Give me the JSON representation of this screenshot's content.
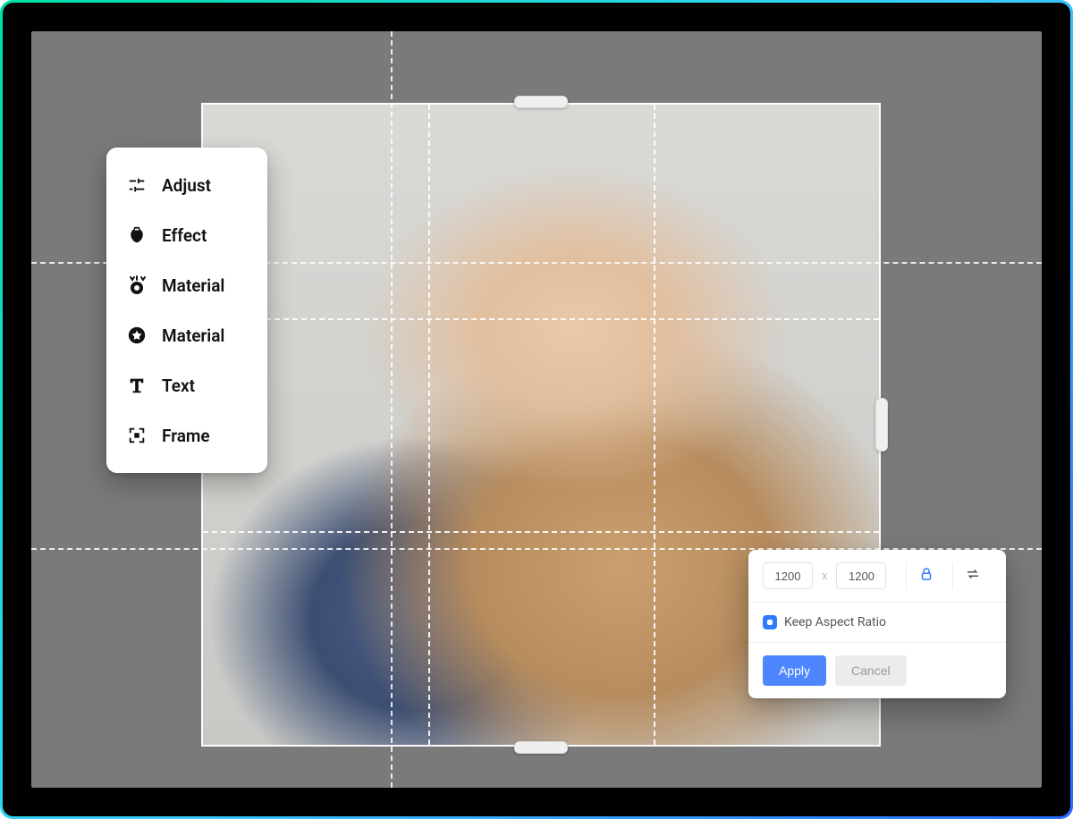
{
  "toolbar": {
    "items": [
      {
        "icon": "adjust-icon",
        "label": "Adjust"
      },
      {
        "icon": "effect-icon",
        "label": "Effect"
      },
      {
        "icon": "material1-icon",
        "label": "Material"
      },
      {
        "icon": "material2-icon",
        "label": "Material"
      },
      {
        "icon": "text-icon",
        "label": "Text"
      },
      {
        "icon": "frame-icon",
        "label": "Frame"
      }
    ]
  },
  "size_panel": {
    "width": "1200",
    "height": "1200",
    "dim_separator": "x",
    "keep_aspect_label": "Keep Aspect Ratio",
    "keep_aspect_checked": true,
    "apply_label": "Apply",
    "cancel_label": "Cancel"
  },
  "colors": {
    "accent": "#4d86ff",
    "lock_icon": "#2f7bff"
  }
}
